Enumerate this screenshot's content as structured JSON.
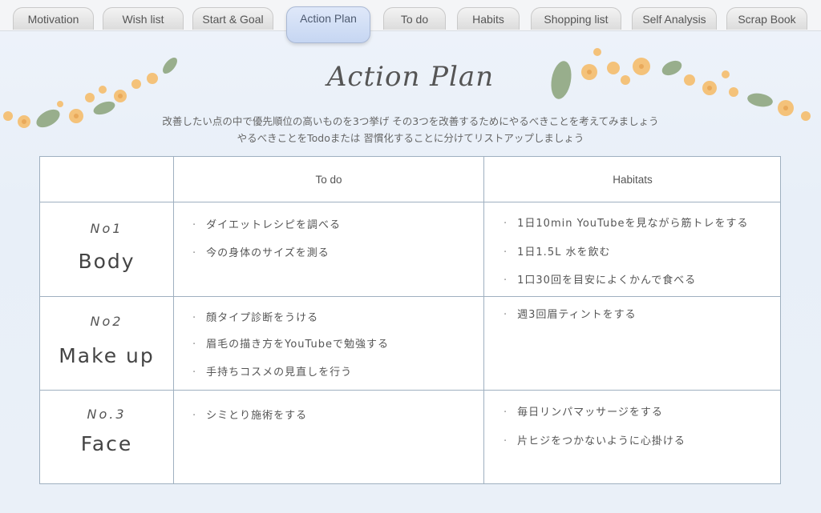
{
  "tabs": [
    {
      "label": "Motivation"
    },
    {
      "label": "Wish list"
    },
    {
      "label": "Start & Goal"
    },
    {
      "label": "Action Plan"
    },
    {
      "label": "To do"
    },
    {
      "label": "Habits"
    },
    {
      "label": "Shopping list"
    },
    {
      "label": "Self Analysis"
    },
    {
      "label": "Scrap Book"
    }
  ],
  "active_tab": "Action Plan",
  "page": {
    "title": "Action Plan",
    "intro_line1": "改善したい点の中で優先順位の高いものを3つ挙げ その3つを改善するためにやるべきことを考えてみましょう",
    "intro_line2": "やるべきことをTodoまたは 習慣化することに分けてリストアップしましょう"
  },
  "table": {
    "col_todo": "To do",
    "col_habits": "Habitats",
    "rows": [
      {
        "num": "No1",
        "name": "Body",
        "todo": [
          "ダイエットレシピを調べる",
          "今の身体のサイズを測る"
        ],
        "habits": [
          "1日10min YouTubeを見ながら筋トレをする",
          "1日1.5L 水を飲む",
          "1口30回を目安によくかんで食べる"
        ]
      },
      {
        "num": "No2",
        "name": "Make up",
        "todo": [
          "顔タイプ診断をうける",
          "眉毛の描き方をYouTubeで勉強する",
          "手持ちコスメの見直しを行う"
        ],
        "habits": [
          "週3回眉ティントをする"
        ]
      },
      {
        "num": "No.3",
        "name": "Face",
        "todo": [
          "シミとり施術をする"
        ],
        "habits": [
          "毎日リンパマッサージをする",
          "片ヒジをつかないように心掛ける"
        ]
      }
    ]
  },
  "colors": {
    "accent_tab": "#c6d6f2",
    "table_border": "#9fb0c0",
    "flower": "#f4c27a",
    "leaf": "#8aa37a"
  }
}
